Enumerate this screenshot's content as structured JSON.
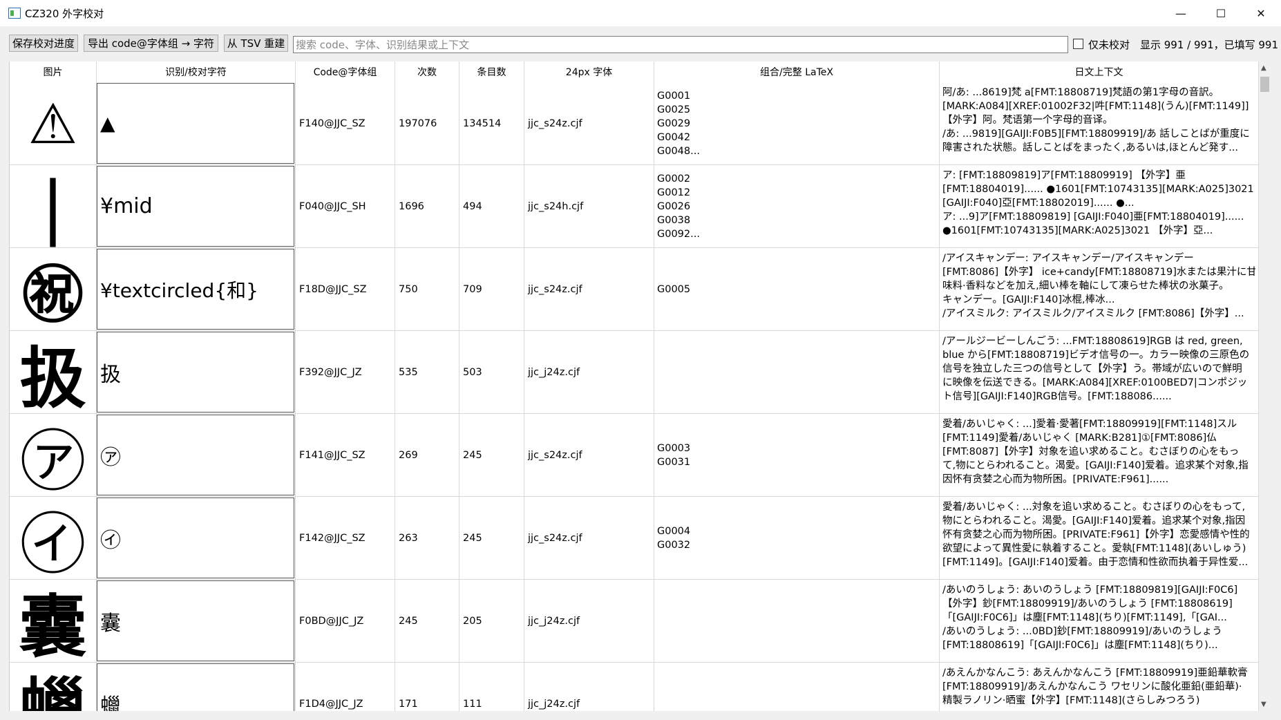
{
  "window": {
    "title": "CZ320 外字校对",
    "minimize": "—",
    "maximize": "☐",
    "close": "✕"
  },
  "toolbar": {
    "save": "保存校对进度",
    "export": "导出 code@字体组 → 字符",
    "rebuild": "从 TSV 重建",
    "search_placeholder": "搜索 code、字体、识别结果或上下文",
    "only_unproofed": "仅未校对",
    "status": "显示 991 / 991，已填写 991"
  },
  "table": {
    "headers": [
      "图片",
      "识别/校对字符",
      "Code@字体组",
      "次数",
      "条目数",
      "24px 字体",
      "组合/完整 LaTeX",
      "日文上下文"
    ],
    "rows": [
      {
        "img": "⚠",
        "recog": "▲",
        "code": "F140@JJC_SZ",
        "count": "197076",
        "entries": "134514",
        "font": "jjc_s24z.cjf",
        "latex": "G0001\nG0025\nG0029\nG0042\nG0048...",
        "ctx": [
          "阿/あ: ...8619]梵 a[FMT:18808719]梵語の第1字母の音訳。",
          "[MARK:A084][XREF:01002F32|吽[FMT:1148](うん)[FMT:1149]]",
          "【外字】阿。梵语第一个字母的音译。",
          "/あ: ...9819][GAIJI:F0B5][FMT:18809919]/あ 話しことばが重度に",
          "障害された状態。話しことばをまったく,あるいは,ほとんど発す..."
        ]
      },
      {
        "img": "|",
        "recog": "¥mid",
        "code": "F040@JJC_SH",
        "count": "1696",
        "entries": "494",
        "font": "jjc_s24h.cjf",
        "latex": "G0002\nG0012\nG0026\nG0038\nG0092...",
        "ctx": [
          "ア: [FMT:18809819]ア[FMT:18809919] 【外字】亜",
          "[FMT:18804019]...... ●1601[FMT:10743135][MARK:A025]3021",
          "[GAIJI:F040]亞[FMT:18802019]...... ●...",
          "ア: ...9]ア[FMT:18809819] [GAIJI:F040]亜[FMT:18804019]......",
          "●1601[FMT:10743135][MARK:A025]3021 【外字】亞..."
        ]
      },
      {
        "img": "㊗",
        "recog": "¥textcircled{和}",
        "code": "F18D@JJC_SZ",
        "count": "750",
        "entries": "709",
        "font": "jjc_s24z.cjf",
        "latex": "G0005",
        "ctx": [
          "/アイスキャンデー: アイスキャンデー/アイスキャンデー",
          "[FMT:8086]【外字】 ice+candy[FMT:18808719]水または果汁に甘",
          "味料·香料などを加え,細い棒を軸にして凍らせた棒状の氷菓子。",
          "キャンデー。[GAIJI:F140]冰棍,棒冰...",
          "/アイスミルク: アイスミルク/アイスミルク [FMT:8086]【外字】..."
        ]
      },
      {
        "img": "扱",
        "recog": "扱",
        "code": "F392@JJC_JZ",
        "count": "535",
        "entries": "503",
        "font": "jjc_j24z.cjf",
        "latex": "",
        "ctx": [
          "/アールジービーしんごう: ...FMT:18808619]RGB は red, green,",
          "blue から[FMT:18808719]ビデオ信号の一。カラー映像の三原色の",
          "信号を独立した三つの信号として【外字】う。帯域が広いので鮮明",
          "に映像を伝送できる。[MARK:A084][XREF:0100BED7|コンポジッ",
          "ト信号][GAIJI:F140]RGB信号。[FMT:188086......"
        ]
      },
      {
        "img": "㋐",
        "recog": "㋐",
        "code": "F141@JJC_SZ",
        "count": "269",
        "entries": "245",
        "font": "jjc_s24z.cjf",
        "latex": "G0003\nG0031",
        "ctx": [
          "愛着/あいじゃく: ...]愛着·愛著[FMT:18809919][FMT:1148]スル",
          "[FMT:1149]愛着/あいじゃく [MARK:B281]①[FMT:8086]仏",
          "[FMT:8087]【外字】対象を追い求めること。むさぼりの心をもっ",
          "て,物にとらわれること。渴愛。[GAIJI:F140]爱着。追求某个对象,指",
          "因怀有贪婪之心而为物所困。[PRIVATE:F961]......"
        ]
      },
      {
        "img": "㋑",
        "recog": "㋑",
        "code": "F142@JJC_SZ",
        "count": "263",
        "entries": "245",
        "font": "jjc_s24z.cjf",
        "latex": "G0004\nG0032",
        "ctx": [
          "愛着/あいじゃく: ...対象を追い求めること。むさぼりの心をもって,",
          "物にとらわれること。渴愛。[GAIJI:F140]爱着。追求某个对象,指因",
          "怀有贪婪之心而为物所困。[PRIVATE:F961]【外字】恋愛感情や性的",
          "欲望によって異性愛に執着すること。愛執[FMT:1148](あいしゅう)",
          "[FMT:1149]。[GAIJI:F140]爱着。由于恋情和性欲而执着于异性爱..."
        ]
      },
      {
        "img": "囊",
        "recog": "囊",
        "code": "F0BD@JJC_JZ",
        "count": "245",
        "entries": "205",
        "font": "jjc_j24z.cjf",
        "latex": "",
        "ctx": [
          "/あいのうしょう: あいのうしょう [FMT:18809819][GAIJI:F0C6]",
          "【外字】鈔[FMT:18809919]/あいのうしょう [FMT:18808619]",
          "「[GAIJI:F0C6]」は塵[FMT:1148](ちり)[FMT:1149],「[GAI...",
          "/あいのうしょう: ...0BD]鈔[FMT:18809919]/あいのうしょう",
          "[FMT:18808619]「[GAIJI:F0C6]」は塵[FMT:1148](ちり)..."
        ]
      },
      {
        "img": "蠟",
        "recog": "蠟",
        "code": "F1D4@JJC_JZ",
        "count": "171",
        "entries": "111",
        "font": "jjc_j24z.cjf",
        "latex": "",
        "ctx": [
          "/あえんかなんこう: あえんかなんこう [FMT:18809919]亜鉛華軟膏",
          "[FMT:18809919]/あえんかなんこう ワセリンに酸化亜鉛(亜鉛華)·",
          "精製ラノリン·晒蜜【外字】[FMT:1148](さらしみつろう)",
          "",
          ""
        ]
      }
    ]
  }
}
